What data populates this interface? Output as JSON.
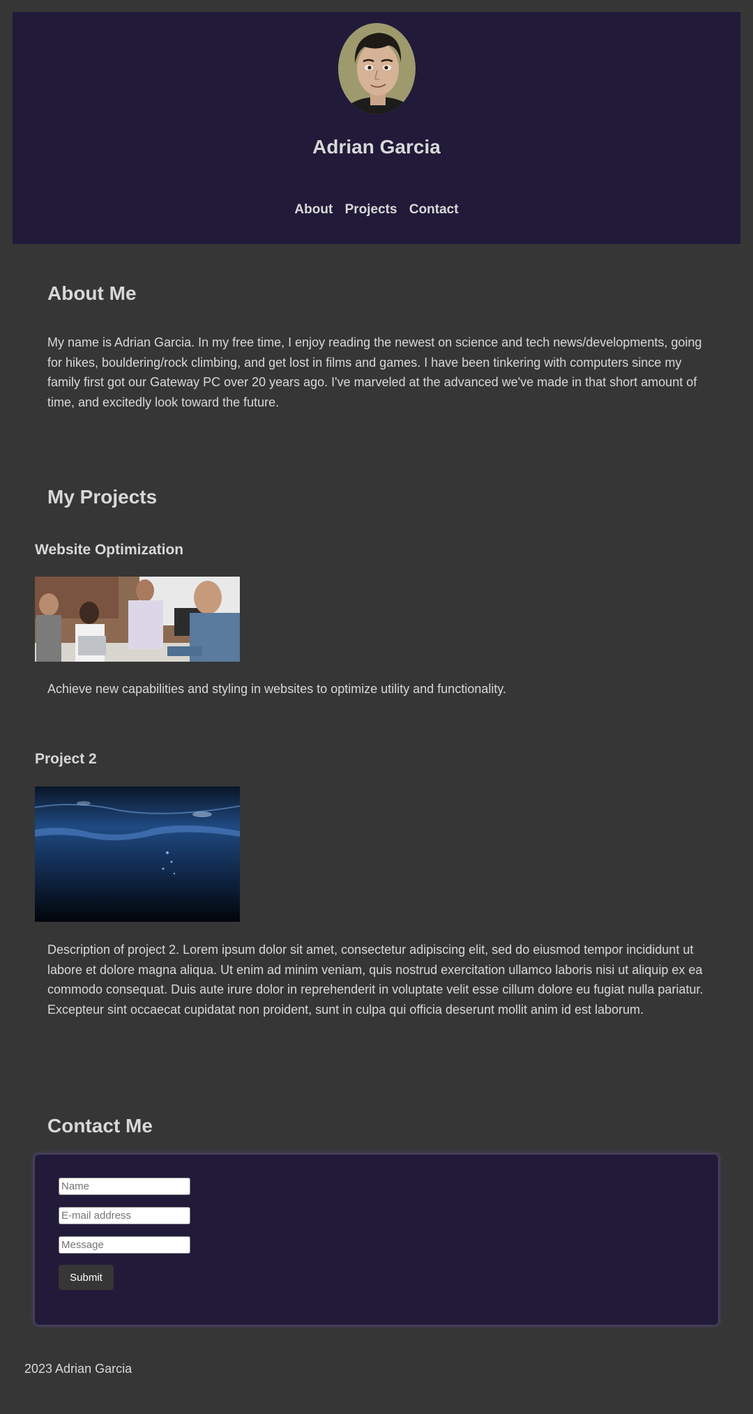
{
  "header": {
    "name": "Adrian Garcia",
    "nav": [
      "About",
      "Projects",
      "Contact"
    ]
  },
  "about": {
    "heading": "About Me",
    "text": "My name is Adrian Garcia. In my free time, I enjoy reading the newest on science and tech news/developments, going for hikes, bouldering/rock climbing, and get lost in films and games. I have been tinkering with computers since my family first got our Gateway PC over 20 years ago. I've marveled at the advanced we've made in that short amount of time, and excitedly look toward the future."
  },
  "projects": {
    "heading": "My Projects",
    "items": [
      {
        "title": "Website Optimization",
        "description": "Achieve new capabilities and styling in websites to optimize utility and functionality."
      },
      {
        "title": "Project 2",
        "description": "Description of project 2. Lorem ipsum dolor sit amet, consectetur adipiscing elit, sed do eiusmod tempor incididunt ut labore et dolore magna aliqua. Ut enim ad minim veniam, quis nostrud exercitation ullamco laboris nisi ut aliquip ex ea commodo consequat. Duis aute irure dolor in reprehenderit in voluptate velit esse cillum dolore eu fugiat nulla pariatur. Excepteur sint occaecat cupidatat non proident, sunt in culpa qui officia deserunt mollit anim id est laborum."
      }
    ]
  },
  "contact": {
    "heading": "Contact Me",
    "name_placeholder": "Name",
    "email_placeholder": "E-mail address",
    "message_placeholder": "Message",
    "submit_label": "Submit"
  },
  "footer": {
    "text": "2023 Adrian Garcia"
  },
  "colors": {
    "background": "#363636",
    "header_bg": "#211a39",
    "text": "#d8d8d8"
  }
}
